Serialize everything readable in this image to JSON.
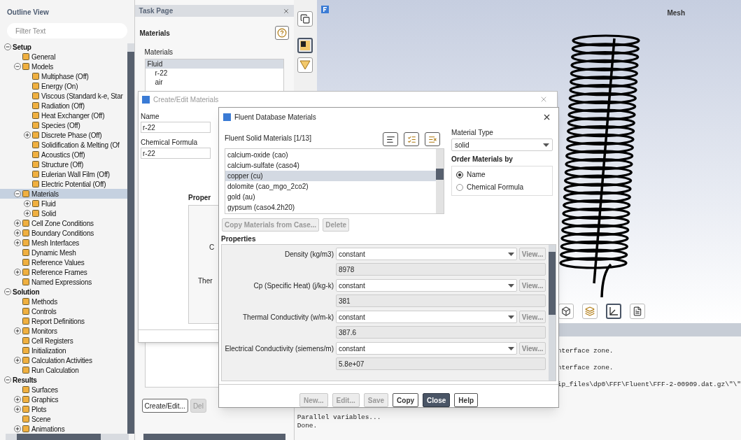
{
  "outline": {
    "title": "Outline View",
    "filter": {
      "placeholder": "Filter Text"
    },
    "tree": [
      {
        "label": "Setup",
        "expanded": true,
        "selected": false,
        "children": [
          {
            "label": "General",
            "selected": false
          },
          {
            "label": "Models",
            "expanded": true,
            "selected": false,
            "children": [
              {
                "label": "Multiphase (Off)",
                "selected": false
              },
              {
                "label": "Energy (On)",
                "selected": false
              },
              {
                "label": "Viscous (Standard k-e, Star",
                "selected": false
              },
              {
                "label": "Radiation (Off)",
                "selected": false
              },
              {
                "label": "Heat Exchanger (Off)",
                "selected": false
              },
              {
                "label": "Species (Off)",
                "selected": false
              },
              {
                "label": "Discrete Phase (Off)",
                "expanded": false,
                "selected": false
              },
              {
                "label": "Solidification & Melting (Of",
                "selected": false
              },
              {
                "label": "Acoustics (Off)",
                "selected": false
              },
              {
                "label": "Structure (Off)",
                "selected": false
              },
              {
                "label": "Eulerian Wall Film (Off)",
                "selected": false
              },
              {
                "label": "Electric Potential (Off)",
                "selected": false
              }
            ]
          },
          {
            "label": "Materials",
            "expanded": true,
            "selected": true,
            "children": [
              {
                "label": "Fluid",
                "expanded": false,
                "selected": false
              },
              {
                "label": "Solid",
                "expanded": false,
                "selected": false
              }
            ]
          },
          {
            "label": "Cell Zone Conditions",
            "expanded": false,
            "selected": false
          },
          {
            "label": "Boundary Conditions",
            "expanded": false,
            "selected": false
          },
          {
            "label": "Mesh Interfaces",
            "expanded": false,
            "selected": false
          },
          {
            "label": "Dynamic Mesh",
            "selected": false
          },
          {
            "label": "Reference Values",
            "selected": false
          },
          {
            "label": "Reference Frames",
            "expanded": false,
            "selected": false
          },
          {
            "label": "Named Expressions",
            "selected": false
          }
        ]
      },
      {
        "label": "Solution",
        "expanded": true,
        "selected": false,
        "children": [
          {
            "label": "Methods",
            "selected": false
          },
          {
            "label": "Controls",
            "selected": false
          },
          {
            "label": "Report Definitions",
            "selected": false
          },
          {
            "label": "Monitors",
            "expanded": false,
            "selected": false
          },
          {
            "label": "Cell Registers",
            "selected": false
          },
          {
            "label": "Initialization",
            "selected": false
          },
          {
            "label": "Calculation Activities",
            "expanded": false,
            "selected": false
          },
          {
            "label": "Run Calculation",
            "selected": false
          }
        ]
      },
      {
        "label": "Results",
        "expanded": true,
        "selected": false,
        "children": [
          {
            "label": "Surfaces",
            "selected": false
          },
          {
            "label": "Graphics",
            "expanded": false,
            "selected": false
          },
          {
            "label": "Plots",
            "expanded": false,
            "selected": false
          },
          {
            "label": "Scene",
            "selected": false
          },
          {
            "label": "Animations",
            "expanded": false,
            "selected": false
          }
        ]
      }
    ]
  },
  "task_page": {
    "title": "Task Page",
    "heading": "Materials",
    "list_label": "Materials",
    "items": [
      {
        "label": "Fluid",
        "kind": "group"
      },
      {
        "label": "r-22",
        "kind": "item"
      },
      {
        "label": "air",
        "kind": "item"
      }
    ],
    "buttons": [
      {
        "label": "Create/Edit...",
        "disabled": false
      },
      {
        "label": "Del",
        "disabled": true
      }
    ]
  },
  "side_tools": [
    {
      "selected": false
    },
    {
      "selected": true
    },
    {
      "selected": false
    }
  ],
  "graphics": {
    "title": "Mesh",
    "tools": [
      {
        "selected": false
      },
      {
        "selected": false
      },
      {
        "selected": true
      },
      {
        "selected": false
      }
    ]
  },
  "console": {
    "lines": [
      {
        "text": "nterface zone.",
        "kind": "partial"
      },
      {
        "text": "nterface zone.",
        "kind": "partial"
      },
      {
        "text": "ip_files\\dp0\\FFF\\Fluent\\FFF-2-00909.dat.gz\\\"\\\"",
        "kind": "partial"
      },
      {
        "text": "Parallel variables...",
        "kind": "full"
      },
      {
        "text": "Done.",
        "kind": "full"
      }
    ]
  },
  "create_dialog": {
    "title": "Create/Edit Materials",
    "fields": [
      {
        "label": "Name",
        "value": "r-22"
      },
      {
        "label": "Chemical Formula",
        "value": "r-22"
      }
    ],
    "properties_heading": "Proper",
    "property_labels": [
      "C",
      "Ther"
    ]
  },
  "database_dialog": {
    "title": "Fluent Database Materials",
    "list_label": "Fluent Solid Materials [1/13]",
    "materials": [
      {
        "label": "calcium-oxide (cao)",
        "selected": false
      },
      {
        "label": "calcium-sulfate (caso4)",
        "selected": false
      },
      {
        "label": "copper (cu)",
        "selected": true
      },
      {
        "label": "dolomite (cao_mgo_2co2)",
        "selected": false
      },
      {
        "label": "gold (au)",
        "selected": false
      },
      {
        "label": "gypsum (caso4.2h20)",
        "selected": false
      }
    ],
    "material_type": {
      "label": "Material Type",
      "value": "solid"
    },
    "order": {
      "label": "Order Materials by",
      "options": [
        {
          "label": "Name",
          "selected": true
        },
        {
          "label": "Chemical Formula",
          "selected": false
        }
      ]
    },
    "list_buttons": [
      {
        "label": "Copy Materials from Case...",
        "disabled": true
      },
      {
        "label": "Delete",
        "disabled": true
      }
    ],
    "properties_heading": "Properties",
    "properties": [
      {
        "label": "Density (kg/m3)",
        "method": "constant",
        "value": "8978",
        "button": "View..."
      },
      {
        "label": "Cp (Specific Heat) (j/kg-k)",
        "method": "constant",
        "value": "381",
        "button": "View..."
      },
      {
        "label": "Thermal Conductivity (w/m-k)",
        "method": "constant",
        "value": "387.6",
        "button": "View..."
      },
      {
        "label": "Electrical Conductivity (siemens/m)",
        "method": "constant",
        "value": "5.8e+07",
        "button": "View..."
      }
    ],
    "buttons": [
      {
        "label": "New...",
        "kind": "normal",
        "disabled": true
      },
      {
        "label": "Edit...",
        "kind": "normal",
        "disabled": true
      },
      {
        "label": "Save",
        "kind": "normal",
        "disabled": true
      },
      {
        "label": "Copy",
        "kind": "normal",
        "disabled": false
      },
      {
        "label": "Close",
        "kind": "primary",
        "disabled": false
      },
      {
        "label": "Help",
        "kind": "normal",
        "disabled": false
      }
    ]
  }
}
